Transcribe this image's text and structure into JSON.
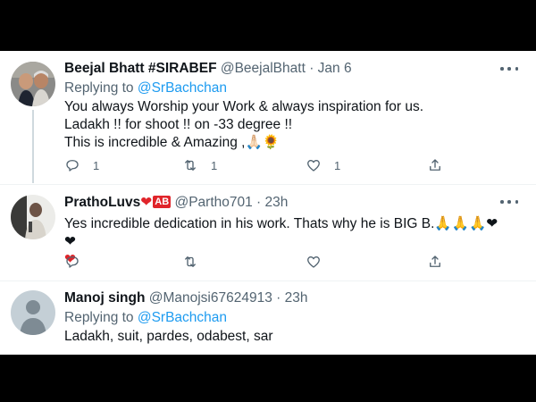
{
  "tweets": [
    {
      "name": "Beejal Bhatt #SIRABEF",
      "handle": "@BeejalBhatt",
      "time": "· Jan 6",
      "replying_prefix": "Replying to",
      "replying_to": "@SrBachchan",
      "lines": [
        "You always Worship your Work & always inspiration for us.",
        "Ladakh !! for shoot !! on -33 degree !!",
        "This is incredible & Amazing ,🙏🏻🌻"
      ],
      "replies": "1",
      "retweets": "1",
      "likes": "1"
    },
    {
      "name": "PrathoLuvs",
      "name_emoji": "❤",
      "name_badge": "AB",
      "handle": "@Partho701",
      "time": "· 23h",
      "lines": [
        "Yes incredible dedication in his work. Thats why he is BIG B.🙏🙏🙏❤❤",
        "❤"
      ],
      "replies": "",
      "retweets": "",
      "likes": ""
    },
    {
      "name": "Manoj singh",
      "handle": "@Manojsi67624913",
      "time": "· 23h",
      "replying_prefix": "Replying to",
      "replying_to": "@SrBachchan",
      "lines": [
        "Ladakh, suit, pardes, odabest, sar"
      ]
    }
  ],
  "icons": [
    "reply-icon",
    "retweet-icon",
    "like-icon",
    "share-icon",
    "more-icon"
  ],
  "colors": {
    "mention": "#1d9bf0",
    "secondary_text": "#536471",
    "heart": "#e0242a"
  }
}
